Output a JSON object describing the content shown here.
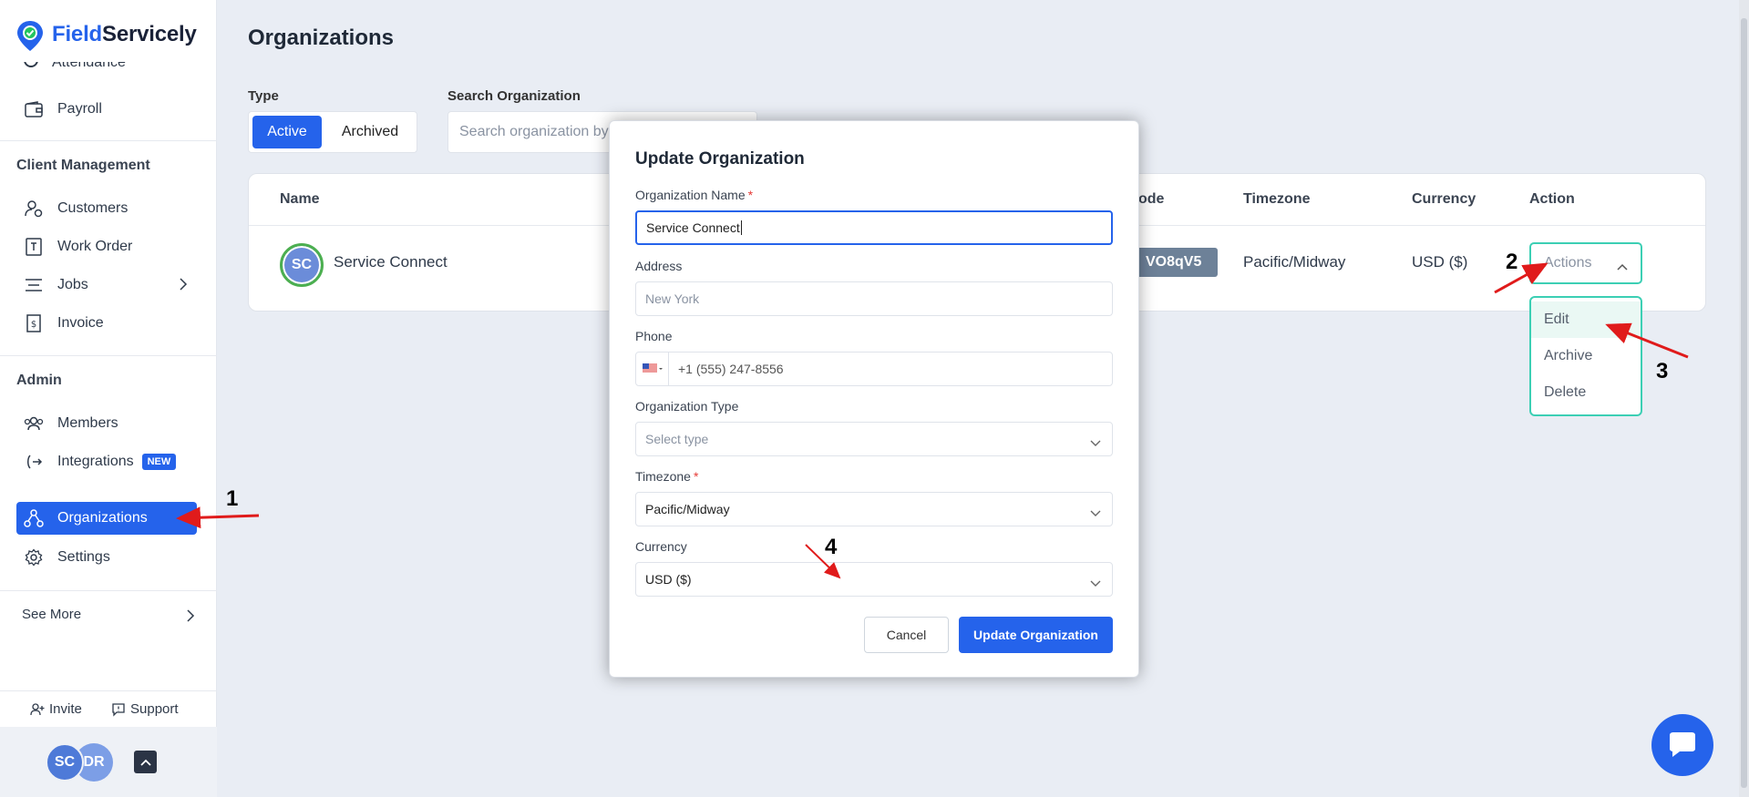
{
  "app": {
    "name_part1": "Field",
    "name_part2": "Servicely",
    "brand_color": "#2563eb"
  },
  "sidebar": {
    "partial_item": "Attendance",
    "payroll": "Payroll",
    "client_section": "Client Management",
    "client_items": [
      "Customers",
      "Work Order",
      "Jobs",
      "Invoice"
    ],
    "admin_section": "Admin",
    "members": "Members",
    "integrations": "Integrations",
    "new_badge": "NEW",
    "organizations": "Organizations",
    "settings": "Settings",
    "see_more": "See More",
    "invite": "Invite",
    "support": "Support",
    "avatars": [
      "SC",
      "DR"
    ]
  },
  "main": {
    "title": "Organizations",
    "type_label": "Type",
    "type_options": [
      "Active",
      "Archived"
    ],
    "search_label": "Search Organization",
    "search_placeholder": "Search organization by name",
    "columns": [
      "Name",
      "ode",
      "Timezone",
      "Currency",
      "Action"
    ],
    "row": {
      "initials": "SC",
      "name": "Service Connect",
      "code": "VO8qV5",
      "timezone": "Pacific/Midway",
      "currency": "USD ($)",
      "actions_label": "Actions"
    },
    "actions_menu": [
      "Edit",
      "Archive",
      "Delete"
    ]
  },
  "modal": {
    "title": "Update Organization",
    "name_label": "Organization Name",
    "name_value": "Service Connect",
    "address_label": "Address",
    "address_placeholder": "New York",
    "phone_label": "Phone",
    "phone_placeholder": "+1 (555) 247-8556",
    "type_label": "Organization Type",
    "type_placeholder": "Select type",
    "timezone_label": "Timezone",
    "timezone_value": "Pacific/Midway",
    "currency_label": "Currency",
    "currency_value": "USD ($)",
    "required_mark": "*",
    "cancel": "Cancel",
    "submit": "Update Organization"
  },
  "annotations": [
    "1",
    "2",
    "3",
    "4"
  ],
  "colors": {
    "accent": "#2563eb",
    "teal_border": "#3ccfb4",
    "arrow": "#e01b1b",
    "code_chip": "#6d8198"
  }
}
